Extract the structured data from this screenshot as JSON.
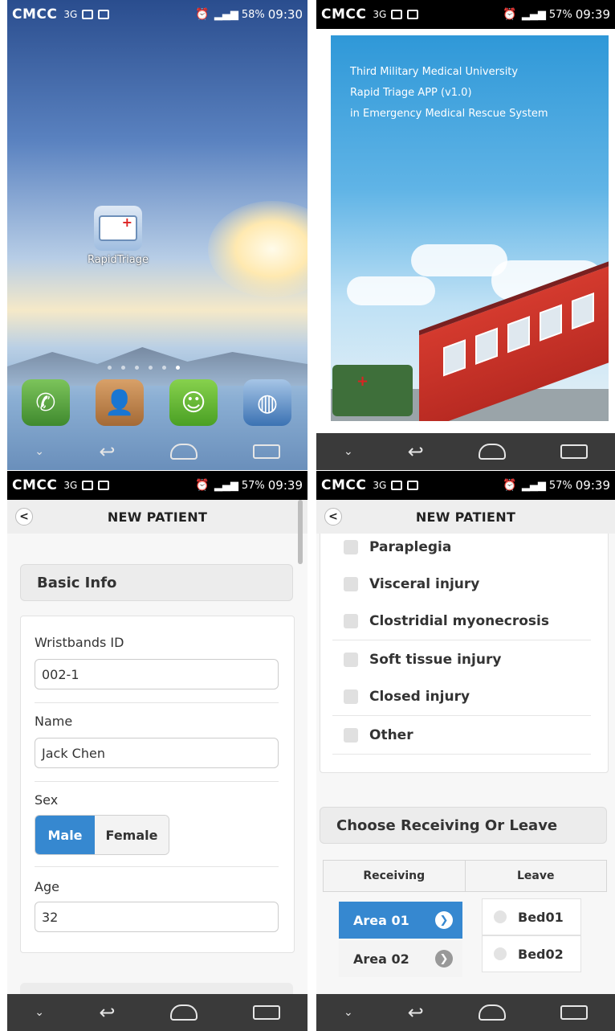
{
  "status_bars": [
    {
      "carrier": "CMCC",
      "network": "3G",
      "signal": "3G",
      "battery": "58%",
      "time": "09:30"
    },
    {
      "carrier": "CMCC",
      "network": "3G",
      "signal": "3G",
      "battery": "57%",
      "time": "09:39"
    },
    {
      "carrier": "CMCC",
      "network": "3G",
      "signal": "3G",
      "battery": "57%",
      "time": "09:39"
    },
    {
      "carrier": "CMCC",
      "network": "3G",
      "signal": "3G",
      "battery": "57%",
      "time": "09:39"
    }
  ],
  "home": {
    "app_label": "RapidTriage",
    "page_dots": 6,
    "active_dot": 6,
    "dock": [
      "phone-icon",
      "contacts-icon",
      "messages-icon",
      "browser-globe-icon"
    ]
  },
  "splash": {
    "line1": "Third Military Medical University",
    "line2": "Rapid Triage APP (v1.0)",
    "line3": "in Emergency Medical Rescue System"
  },
  "form_left": {
    "title": "NEW PATIENT",
    "section_basic": "Basic Info",
    "wristband_label": "Wristbands ID",
    "wristband_value": "002-1",
    "name_label": "Name",
    "name_value": "Jack Chen",
    "sex_label": "Sex",
    "sex_options": [
      "Male",
      "Female"
    ],
    "sex_selected": "Male",
    "age_label": "Age",
    "age_value": "32"
  },
  "form_right": {
    "title": "NEW PATIENT",
    "injuries": [
      "Paraplegia",
      "Visceral injury",
      "Clostridial myonecrosis",
      "Soft tissue injury",
      "Closed injury",
      "Other"
    ],
    "section_receiving": "Choose Receiving Or Leave",
    "tabs": [
      "Receiving",
      "Leave"
    ],
    "areas": [
      "Area 01",
      "Area 02"
    ],
    "active_area": "Area 01",
    "beds": [
      "Bed01",
      "Bed02"
    ]
  },
  "colors": {
    "accent": "#3688d0",
    "appbar": "#eeeeee",
    "navbar": "#3a3a3a"
  }
}
